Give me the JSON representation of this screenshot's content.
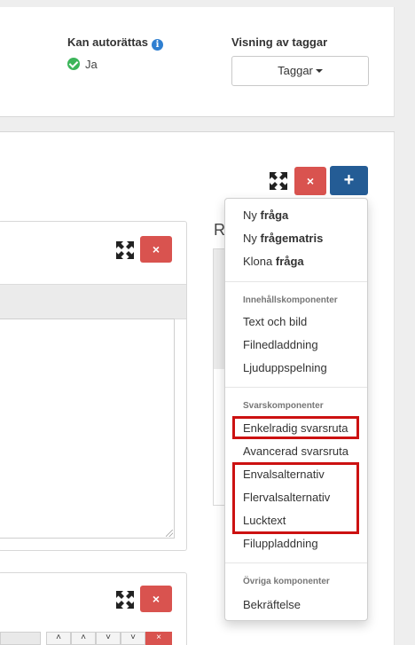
{
  "header": {
    "kan_autorattas_label": "Kan autorättas",
    "info_icon_glyph": "i",
    "kan_autorattas_value": "Ja",
    "visning_label": "Visning av taggar",
    "taggar_button": "Taggar"
  },
  "toolbar": {
    "remove_glyph": "×",
    "add_glyph": "+"
  },
  "right_panel": {
    "letter": "R"
  },
  "menu": {
    "new_question_prefix": "Ny ",
    "new_question_bold": "fråga",
    "new_matrix_prefix": "Ny ",
    "new_matrix_bold": "frågematris",
    "clone_prefix": "Klona ",
    "clone_bold": "fråga",
    "content_header": "Innehållskomponenter",
    "content_items": [
      "Text och bild",
      "Filnedladdning",
      "Ljuduppspelning"
    ],
    "answer_header": "Svarskomponenter",
    "answer_items": [
      "Enkelradig svarsruta",
      "Avancerad svarsruta",
      "Envalsalternativ",
      "Flervalsalternativ",
      "Lucktext",
      "Filuppladdning"
    ],
    "other_header": "Övriga komponenter",
    "other_items": [
      "Bekräftelse"
    ]
  },
  "colors": {
    "danger": "#d9534f",
    "primary": "#245c95",
    "success": "#3cb55a",
    "info": "#2f7fd1",
    "highlight": "#cc1111"
  },
  "icons": [
    "info-icon",
    "check-icon",
    "caret-down-icon",
    "expand-icon",
    "close-icon",
    "plus-icon",
    "resize-grip-icon",
    "chevron-up-icon",
    "chevron-down-icon"
  ]
}
